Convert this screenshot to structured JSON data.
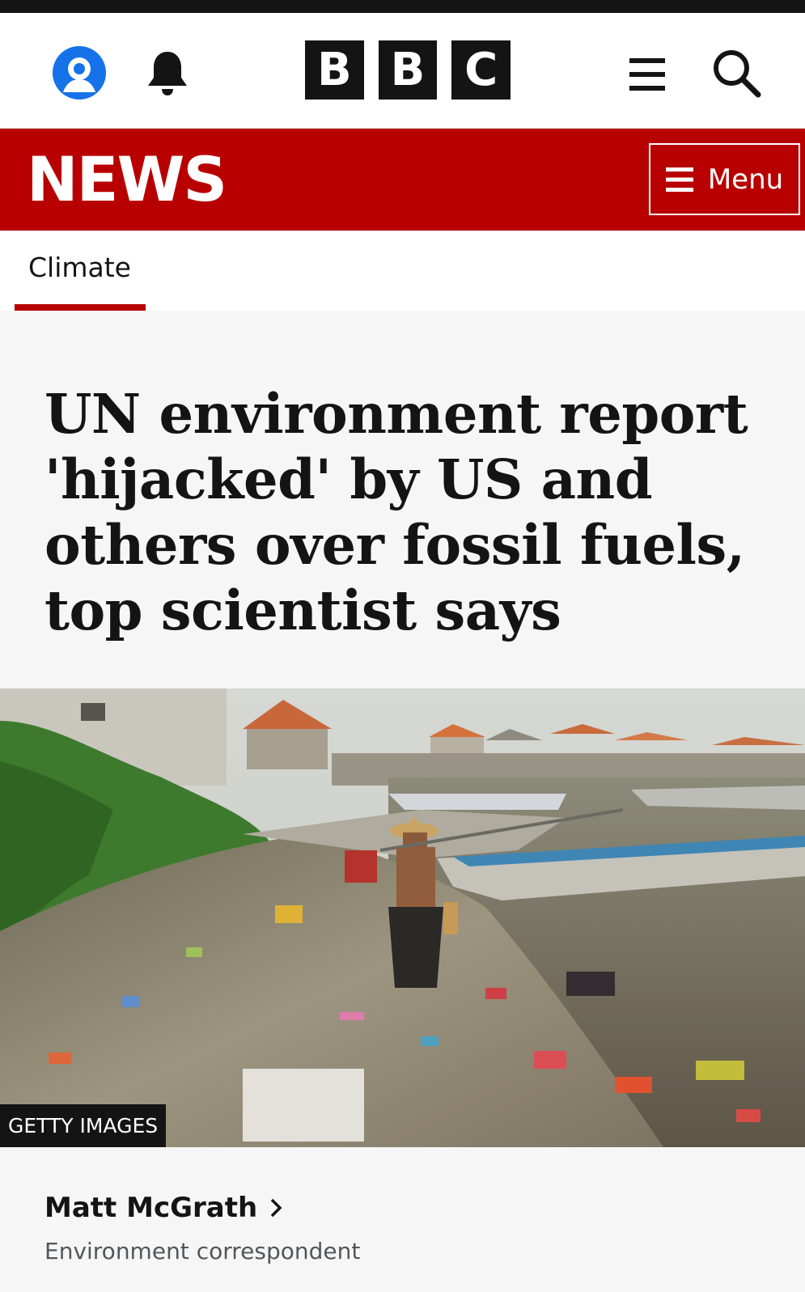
{
  "masthead": {
    "account_icon": "account-icon",
    "notifications_icon": "bell-icon",
    "logo_letters": [
      "B",
      "B",
      "C"
    ],
    "menu_icon": "hamburger-icon",
    "search_icon": "search-icon"
  },
  "news_bar": {
    "wordmark": "NEWS",
    "menu_label": "Menu",
    "menu_icon": "hamburger-icon",
    "color": "#b80000"
  },
  "section_nav": {
    "active": "Climate"
  },
  "article": {
    "headline": "UN environment report 'hijacked' by US and others over fossil fuels, top scientist says",
    "image": {
      "description": "person carrying a motor through plastic waste on a shore beside boats",
      "credit": "GETTY IMAGES"
    },
    "byline": {
      "author": "Matt McGrath",
      "role": "Environment correspondent",
      "chevron_icon": "chevron-right-icon"
    }
  },
  "colors": {
    "brand_red": "#b80000",
    "text": "#141414",
    "page_bg": "#f6f6f6"
  }
}
